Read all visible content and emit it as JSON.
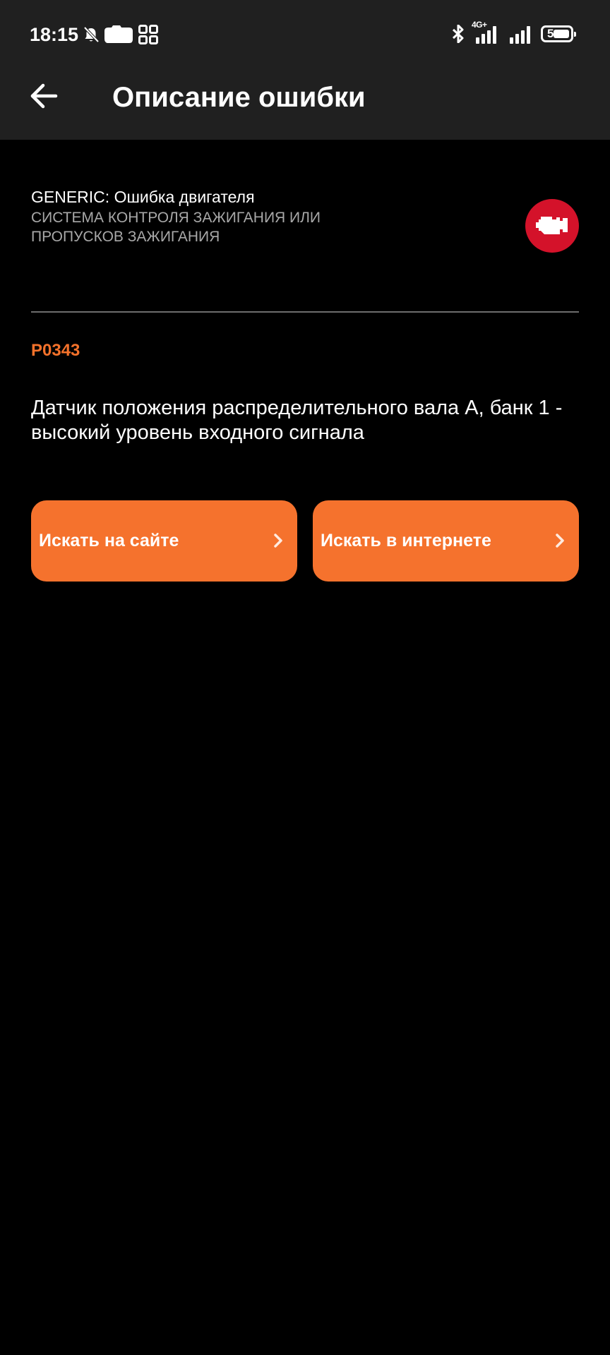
{
  "status_bar": {
    "time": "18:15",
    "network_label": "4G+",
    "battery_level": "5"
  },
  "app_bar": {
    "title": "Описание ошибки"
  },
  "error": {
    "category_title": "GENERIC: Ошибка двигателя",
    "system_name": "СИСТЕМА КОНТРОЛЯ ЗАЖИГАНИЯ ИЛИ ПРОПУСКОВ ЗАЖИГАНИЯ",
    "code": "P0343",
    "description": "Датчик положения распределительного вала А, банк 1 - высокий уровень входного сигнала"
  },
  "actions": {
    "search_site_label": "Искать на сайте",
    "search_web_label": "Искать в интернете"
  },
  "colors": {
    "accent": "#f5722d",
    "code_color": "#f4722b",
    "badge": "#d4122a",
    "app_bar": "#202020",
    "background": "#000000"
  },
  "icons": {
    "back": "back-arrow-icon",
    "engine": "check-engine-icon",
    "chevron": "chevron-right-icon"
  }
}
